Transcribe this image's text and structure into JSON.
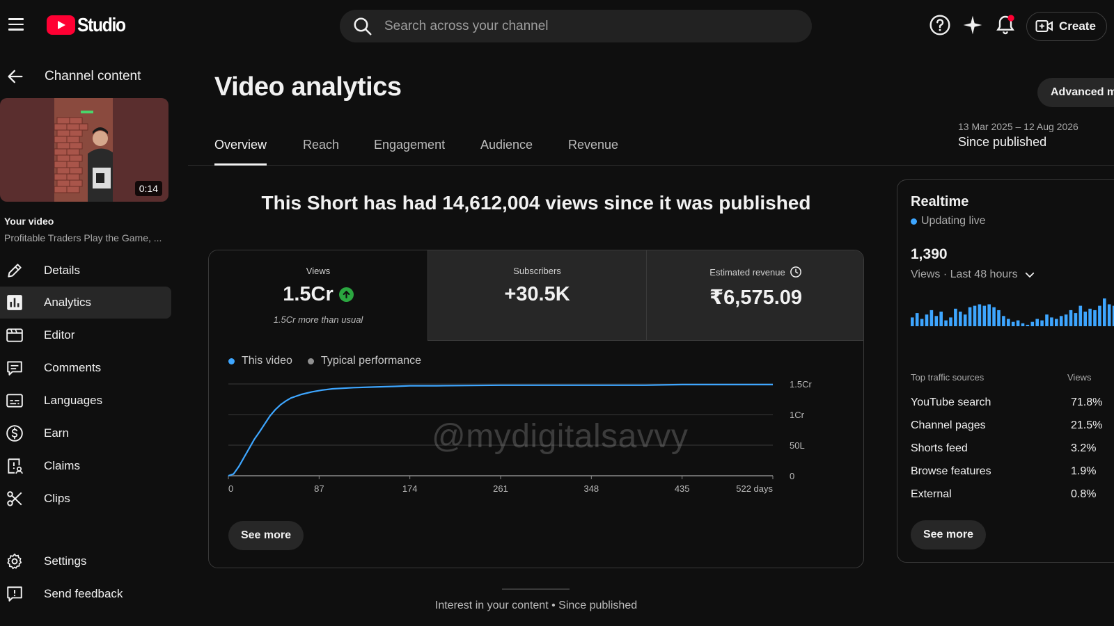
{
  "app": {
    "logo_text": "Studio"
  },
  "search": {
    "placeholder": "Search across your channel"
  },
  "header": {
    "create_label": "Create"
  },
  "sidebar": {
    "back_label": "Channel content",
    "video_duration": "0:14",
    "your_video_label": "Your video",
    "video_title": "Profitable Traders Play the Game, ...",
    "items": [
      {
        "label": "Details",
        "icon": "pencil-icon"
      },
      {
        "label": "Analytics",
        "icon": "analytics-icon",
        "active": true
      },
      {
        "label": "Editor",
        "icon": "editor-icon"
      },
      {
        "label": "Comments",
        "icon": "comments-icon"
      },
      {
        "label": "Languages",
        "icon": "languages-icon"
      },
      {
        "label": "Earn",
        "icon": "dollar-icon"
      },
      {
        "label": "Claims",
        "icon": "claims-icon"
      },
      {
        "label": "Clips",
        "icon": "scissors-icon"
      },
      {
        "label": "Settings",
        "icon": "gear-icon"
      },
      {
        "label": "Send feedback",
        "icon": "feedback-icon"
      }
    ]
  },
  "main": {
    "title": "Video analytics",
    "advanced_label": "Advanced m",
    "date_range": "13 Mar 2025 – 12 Aug 2026",
    "date_label": "Since published",
    "tabs": [
      "Overview",
      "Reach",
      "Engagement",
      "Audience",
      "Revenue"
    ],
    "headline": "This Short has had 14,612,004 views since it was published",
    "metrics": {
      "views_label": "Views",
      "views_value": "1.5Cr",
      "views_note": "1.5Cr more than usual",
      "subs_label": "Subscribers",
      "subs_value": "+30.5K",
      "revenue_label": "Estimated revenue",
      "revenue_value": "₹6,575.09"
    },
    "legend": {
      "this_video": "This video",
      "typical": "Typical performance"
    },
    "see_more": "See more",
    "watermark": "@mydigitalsavvy",
    "interest": "Interest in your content • Since published"
  },
  "realtime": {
    "title": "Realtime",
    "live_label": "Updating live",
    "count": "1,390",
    "sub_label": "Views · Last 48 hours",
    "traffic_header": "Top traffic sources",
    "views_header": "Views",
    "sources": [
      {
        "name": "YouTube search",
        "pct": "71.8%"
      },
      {
        "name": "Channel pages",
        "pct": "21.5%"
      },
      {
        "name": "Shorts feed",
        "pct": "3.2%"
      },
      {
        "name": "Browse features",
        "pct": "1.9%"
      },
      {
        "name": "External",
        "pct": "0.8%"
      }
    ],
    "see_more": "See more",
    "bars": [
      12,
      18,
      10,
      16,
      22,
      14,
      20,
      8,
      12,
      24,
      20,
      16,
      26,
      28,
      30,
      28,
      30,
      26,
      22,
      14,
      10,
      6,
      8,
      4,
      2,
      6,
      10,
      8,
      16,
      12,
      10,
      14,
      16,
      22,
      18,
      28,
      20,
      24,
      22,
      28,
      38,
      30,
      28,
      18,
      10
    ]
  },
  "colors": {
    "accent": "#3ea6ff",
    "brand_red": "#ff0033",
    "up_green": "#2ba640",
    "bg": "#0f0f0f"
  },
  "chart_data": {
    "type": "line",
    "series": [
      {
        "name": "This video",
        "x": [
          0,
          5,
          10,
          15,
          20,
          25,
          30,
          35,
          40,
          45,
          50,
          55,
          60,
          70,
          80,
          90,
          100,
          120,
          140,
          160,
          174,
          200,
          261,
          300,
          348,
          400,
          435,
          480,
          522
        ],
        "y": [
          0.0,
          0.03,
          0.15,
          0.3,
          0.45,
          0.6,
          0.72,
          0.85,
          0.98,
          1.08,
          1.16,
          1.22,
          1.27,
          1.33,
          1.37,
          1.4,
          1.42,
          1.44,
          1.45,
          1.46,
          1.47,
          1.47,
          1.48,
          1.48,
          1.48,
          1.48,
          1.49,
          1.49,
          1.49
        ]
      }
    ],
    "xticks": [
      "0",
      "87",
      "174",
      "261",
      "348",
      "435",
      "522 days"
    ],
    "yticks": [
      "0",
      "50L",
      "1Cr",
      "1.5Cr"
    ],
    "xlim": [
      0,
      522
    ],
    "ylim": [
      0,
      1.5
    ],
    "ylabel_unit": "Cr",
    "grid": true,
    "legend_position": "top-left"
  }
}
